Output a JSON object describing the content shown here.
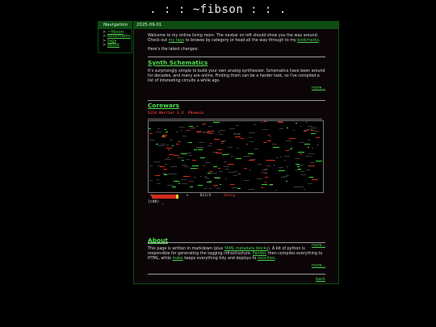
{
  "site": {
    "title": ". : : ~fibson : : ."
  },
  "nav": {
    "header": "Navigation",
    "links": [
      {
        "prefix": "> ",
        "label": "~fibson"
      },
      {
        "prefix": "> ",
        "label": "bookmarks"
      },
      {
        "prefix": "> ",
        "label": "tags"
      },
      {
        "prefix": "> ",
        "label": "about"
      }
    ]
  },
  "main": {
    "date": "2025-09-01",
    "intro": {
      "p1_a": "Welcome to my online living room. The navbar on left should show you the way around. Check out ",
      "p1_link1": "my tags",
      "p1_b": " to browse by category or head all the way through to my ",
      "p1_link2": "bookmarks",
      "p1_c": ".",
      "p2": "Here's the latest changes:"
    },
    "posts": [
      {
        "title": "Synth Schematics",
        "body": "It's surprisingly simple to build your own analog synthesizer. Schematics have been around for decades, and many are online. Finding them can be a harder task, so I've compiled a list of interesting circuits a while ago.",
        "more": "more..."
      },
      {
        "title": "Corewars",
        "warrior_title": "Silk Warrior 1.3",
        "warrior_author": "Phoenix",
        "status_left": "<",
        "status_right": ">",
        "cycle": "012/4",
        "mode": "Debug",
        "progress": 0.8,
        "prompt": "(cdb) _",
        "colors": {
          "red": "#d42a1c",
          "green": "#3bd43b",
          "dim": "#3a3a3a"
        },
        "more": "more..."
      },
      {
        "title": "About",
        "a": "This page is written in markdown (plus ",
        "l1": "YAML metadata blocks",
        "b": "). A bit of python is responsible for generating the tagging infrastructure. ",
        "l2": "Pandoc",
        "c": " then compiles everything to HTML, while ",
        "l3": "make",
        "d": " keeps everything tidy and deploys to ",
        "l4": "neocities",
        "e": ".",
        "more": "more..."
      }
    ],
    "back": "back"
  }
}
